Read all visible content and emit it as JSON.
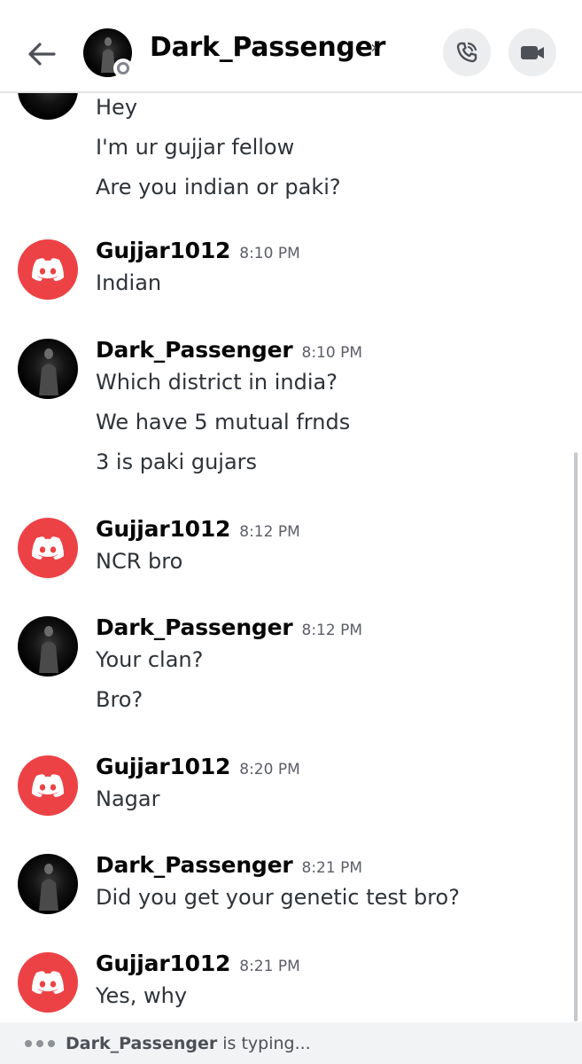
{
  "header": {
    "title": "Dark_Passenger",
    "chevron": "›",
    "status": "offline",
    "icons": {
      "back": "arrow-left-icon",
      "call": "phone-icon",
      "video": "video-camera-icon"
    }
  },
  "partial_top": {
    "lines": [
      "Hey",
      "I'm ur gujjar fellow",
      "Are you indian or paki?"
    ]
  },
  "messages": [
    {
      "user": "Gujjar1012",
      "time": "8:10 PM",
      "avatar": "discord",
      "lines": [
        "Indian"
      ]
    },
    {
      "user": "Dark_Passenger",
      "time": "8:10 PM",
      "avatar": "dark",
      "lines": [
        "Which district in india?",
        "We have 5 mutual frnds",
        "3 is paki gujars"
      ]
    },
    {
      "user": "Gujjar1012",
      "time": "8:12 PM",
      "avatar": "discord",
      "lines": [
        "NCR bro"
      ]
    },
    {
      "user": "Dark_Passenger",
      "time": "8:12 PM",
      "avatar": "dark",
      "lines": [
        "Your clan?",
        "Bro?"
      ]
    },
    {
      "user": "Gujjar1012",
      "time": "8:20 PM",
      "avatar": "discord",
      "lines": [
        "Nagar"
      ]
    },
    {
      "user": "Dark_Passenger",
      "time": "8:21 PM",
      "avatar": "dark",
      "lines": [
        "Did you get your genetic test bro?"
      ]
    },
    {
      "user": "Gujjar1012",
      "time": "8:21 PM",
      "avatar": "discord",
      "lines": [
        "Yes, why"
      ]
    }
  ],
  "typing": {
    "user": "Dark_Passenger",
    "text": "is typing..."
  },
  "colors": {
    "discord_red": "#ed4245",
    "header_button_bg": "#ebedef",
    "typing_bar_bg": "#f2f3f5"
  }
}
